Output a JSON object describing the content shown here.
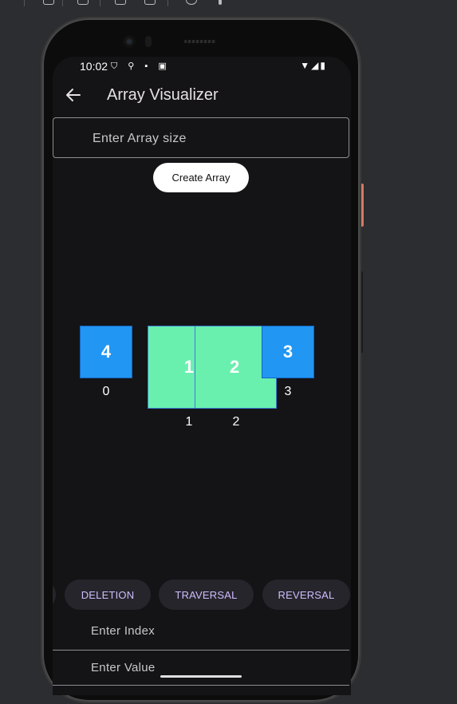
{
  "status_bar": {
    "time": "10:02",
    "left_icons": "⛉ ⚲ ▪ ▣",
    "right_icons": "▼◢▮"
  },
  "app_bar": {
    "title": "Array Visualizer"
  },
  "size_input": {
    "placeholder": "Enter Array size"
  },
  "create_button": {
    "label": "Create Array"
  },
  "array": {
    "cells": [
      {
        "value": "4",
        "index": "0",
        "color": "#2196f3"
      },
      {
        "value": "1",
        "index": "1",
        "color": "#69f0ae"
      },
      {
        "value": "2",
        "index": "2",
        "color": "#69f0ae"
      },
      {
        "value": "3",
        "index": "3",
        "color": "#2196f3"
      }
    ]
  },
  "operations": {
    "chips": [
      {
        "label": "DELETION"
      },
      {
        "label": "TRAVERSAL"
      },
      {
        "label": "REVERSAL"
      }
    ]
  },
  "index_input": {
    "placeholder": "Enter Index"
  },
  "value_input": {
    "placeholder": "Enter Value"
  },
  "colors": {
    "accent": "#d0bcff",
    "blue_cell": "#2196f3",
    "green_cell": "#69f0ae",
    "background": "#141416"
  }
}
